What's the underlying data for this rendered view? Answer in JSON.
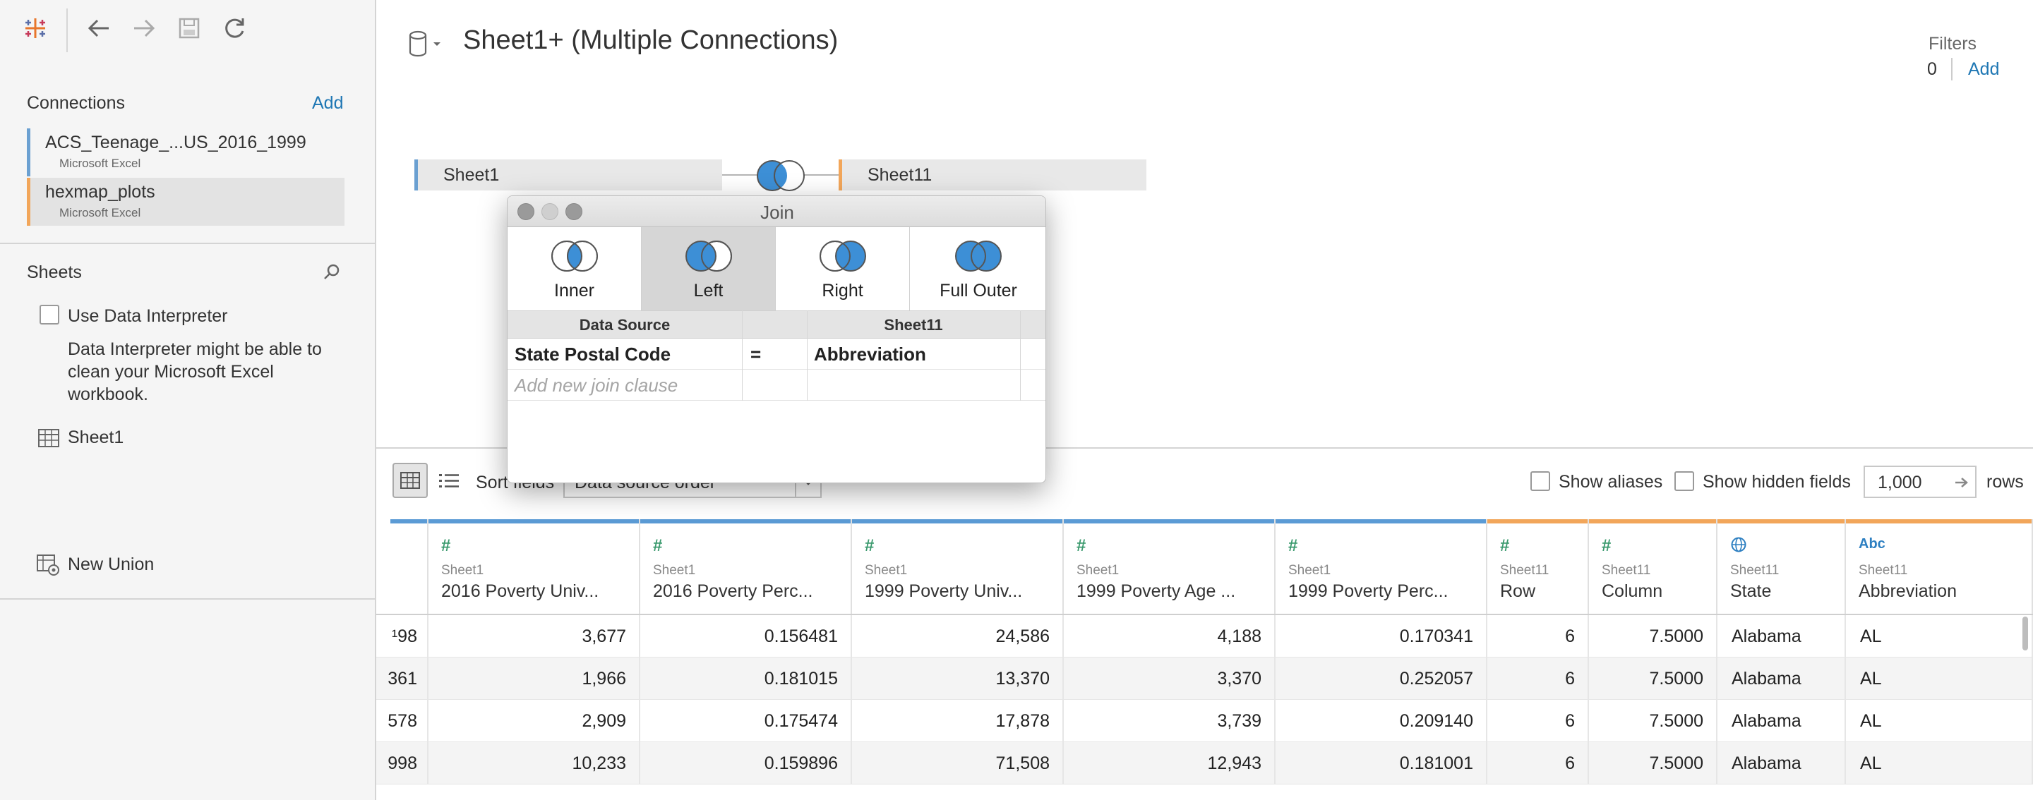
{
  "sidebar": {
    "connections_label": "Connections",
    "add_label": "Add",
    "connections": [
      {
        "name": "ACS_Teenage_...US_2016_1999",
        "type": "Microsoft Excel",
        "color": "#6ba0d1"
      },
      {
        "name": "hexmap_plots",
        "type": "Microsoft Excel",
        "color": "#f2a65a"
      }
    ],
    "sheets_label": "Sheets",
    "use_interpreter_label": "Use Data Interpreter",
    "interpreter_note_lines": [
      "Data Interpreter might be able to",
      "clean your Microsoft Excel",
      "workbook."
    ],
    "sheet_item": "Sheet1",
    "new_union_label": "New Union"
  },
  "datasource": {
    "title": "Sheet1+ (Multiple Connections)",
    "filters_label": "Filters",
    "filters_count": "0",
    "filters_add": "Add"
  },
  "canvas": {
    "left_table": "Sheet1",
    "right_table": "Sheet11"
  },
  "toolbar": {
    "sort_label": "Sort fields",
    "sort_value": "Data source order",
    "show_aliases": "Show aliases",
    "show_hidden": "Show hidden fields",
    "rows_value": "1,000",
    "rows_label": "rows"
  },
  "grid": {
    "columns": [
      {
        "source": "",
        "type": "",
        "name": "",
        "topcolor": "#5b9bd5"
      },
      {
        "source": "Sheet1",
        "type": "#",
        "name": "2016 Poverty Univ...",
        "topcolor": "#5b9bd5"
      },
      {
        "source": "Sheet1",
        "type": "#",
        "name": "2016 Poverty Perc...",
        "topcolor": "#5b9bd5"
      },
      {
        "source": "Sheet1",
        "type": "#",
        "name": "1999 Poverty Univ...",
        "topcolor": "#5b9bd5"
      },
      {
        "source": "Sheet1",
        "type": "#",
        "name": "1999 Poverty Age ...",
        "topcolor": "#5b9bd5"
      },
      {
        "source": "Sheet1",
        "type": "#",
        "name": "1999 Poverty Perc...",
        "topcolor": "#5b9bd5"
      },
      {
        "source": "Sheet11",
        "type": "#",
        "name": "Row",
        "topcolor": "#f2a65a"
      },
      {
        "source": "Sheet11",
        "type": "#",
        "name": "Column",
        "topcolor": "#f2a65a"
      },
      {
        "source": "Sheet11",
        "type": "globe",
        "name": "State",
        "topcolor": "#f2a65a"
      },
      {
        "source": "Sheet11",
        "type": "Abc",
        "name": "Abbreviation",
        "topcolor": "#f2a65a"
      }
    ],
    "rows": [
      [
        "¹98",
        "3,677",
        "0.156481",
        "24,586",
        "4,188",
        "0.170341",
        "6",
        "7.5000",
        "Alabama",
        "AL"
      ],
      [
        "361",
        "1,966",
        "0.181015",
        "13,370",
        "3,370",
        "0.252057",
        "6",
        "7.5000",
        "Alabama",
        "AL"
      ],
      [
        "578",
        "2,909",
        "0.175474",
        "17,878",
        "3,739",
        "0.209140",
        "6",
        "7.5000",
        "Alabama",
        "AL"
      ],
      [
        "998",
        "10,233",
        "0.159896",
        "71,508",
        "12,943",
        "0.181001",
        "6",
        "7.5000",
        "Alabama",
        "AL"
      ],
      [
        "",
        "",
        "",
        "",
        "",
        "",
        "",
        "",
        "",
        ""
      ]
    ]
  },
  "join_dialog": {
    "title": "Join",
    "types": [
      "Inner",
      "Left",
      "Right",
      "Full Outer"
    ],
    "selected": "Left",
    "header_left": "Data Source",
    "header_right": "Sheet11",
    "clause_left": "State Postal Code",
    "clause_op": "=",
    "clause_right": "Abbreviation",
    "add_clause_placeholder": "Add new join clause"
  },
  "colors": {
    "accent": "#1f77b4",
    "venn_fill": "#3d8fd6",
    "sheet1_color": "#6ba0d1",
    "sheet11_color": "#f2a65a"
  }
}
